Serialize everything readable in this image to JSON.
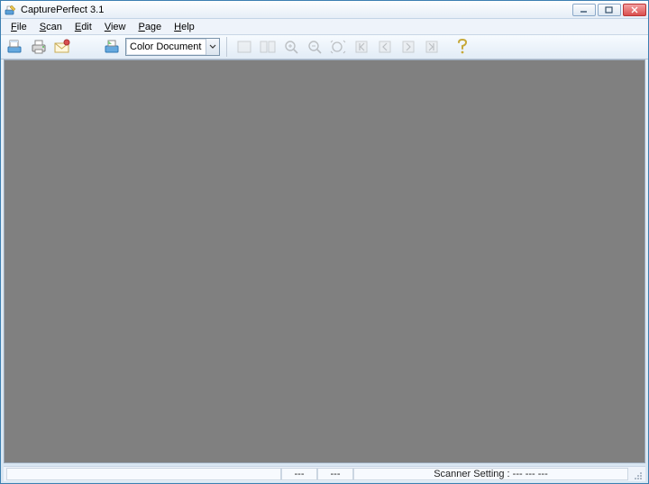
{
  "window": {
    "title": "CapturePerfect 3.1"
  },
  "menu": {
    "file": {
      "label": "File",
      "accel": "F"
    },
    "scan": {
      "label": "Scan",
      "accel": "S"
    },
    "edit": {
      "label": "Edit",
      "accel": "E"
    },
    "view": {
      "label": "View",
      "accel": "V"
    },
    "page": {
      "label": "Page",
      "accel": "P"
    },
    "help": {
      "label": "Help",
      "accel": "H"
    }
  },
  "toolbar": {
    "scan_mode_selected": "Color Document"
  },
  "status": {
    "left_spacer": "",
    "cell_a": "---",
    "cell_b": "---",
    "scanner_setting_label": "Scanner Setting :",
    "scanner_setting_value": "---  ---  ---"
  }
}
